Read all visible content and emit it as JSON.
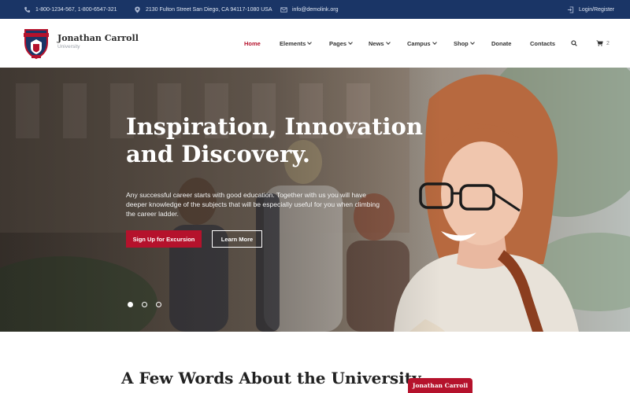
{
  "topbar": {
    "phone": "1-800-1234-567, 1-800-6547-321",
    "address": "2130 Fulton Street San Diego, CA 94117-1080 USA",
    "email": "info@demolink.org",
    "login": "Login/Register",
    "icons": [
      "phone-icon",
      "map-pin-icon",
      "mail-icon",
      "login-icon"
    ]
  },
  "brand": {
    "title": "Jonathan Carroll",
    "subtitle": "University"
  },
  "nav": {
    "items": [
      {
        "label": "Home",
        "active": true
      },
      {
        "label": "Elements",
        "dropdown": true
      },
      {
        "label": "Pages",
        "dropdown": true
      },
      {
        "label": "News",
        "dropdown": true
      },
      {
        "label": "Campus",
        "dropdown": true
      },
      {
        "label": "Shop",
        "dropdown": true
      },
      {
        "label": "Donate"
      },
      {
        "label": "Contacts"
      }
    ],
    "cart_count": "2"
  },
  "hero": {
    "title": "Inspiration, Innovation and Discovery.",
    "text": "Any successful career starts with good education. Together with us you will have deeper knowledge of the subjects that will be especially useful for you when climbing the career ladder.",
    "primary_button": "Sign Up for Excursion",
    "secondary_button": "Learn More",
    "slides": 3,
    "active_slide": 1
  },
  "about": {
    "title": "A Few Words About the University",
    "badge": "Jonathan Carroll"
  },
  "colors": {
    "topbar": "#1a3566",
    "accent": "#b5122c",
    "text_dark": "#222222"
  }
}
